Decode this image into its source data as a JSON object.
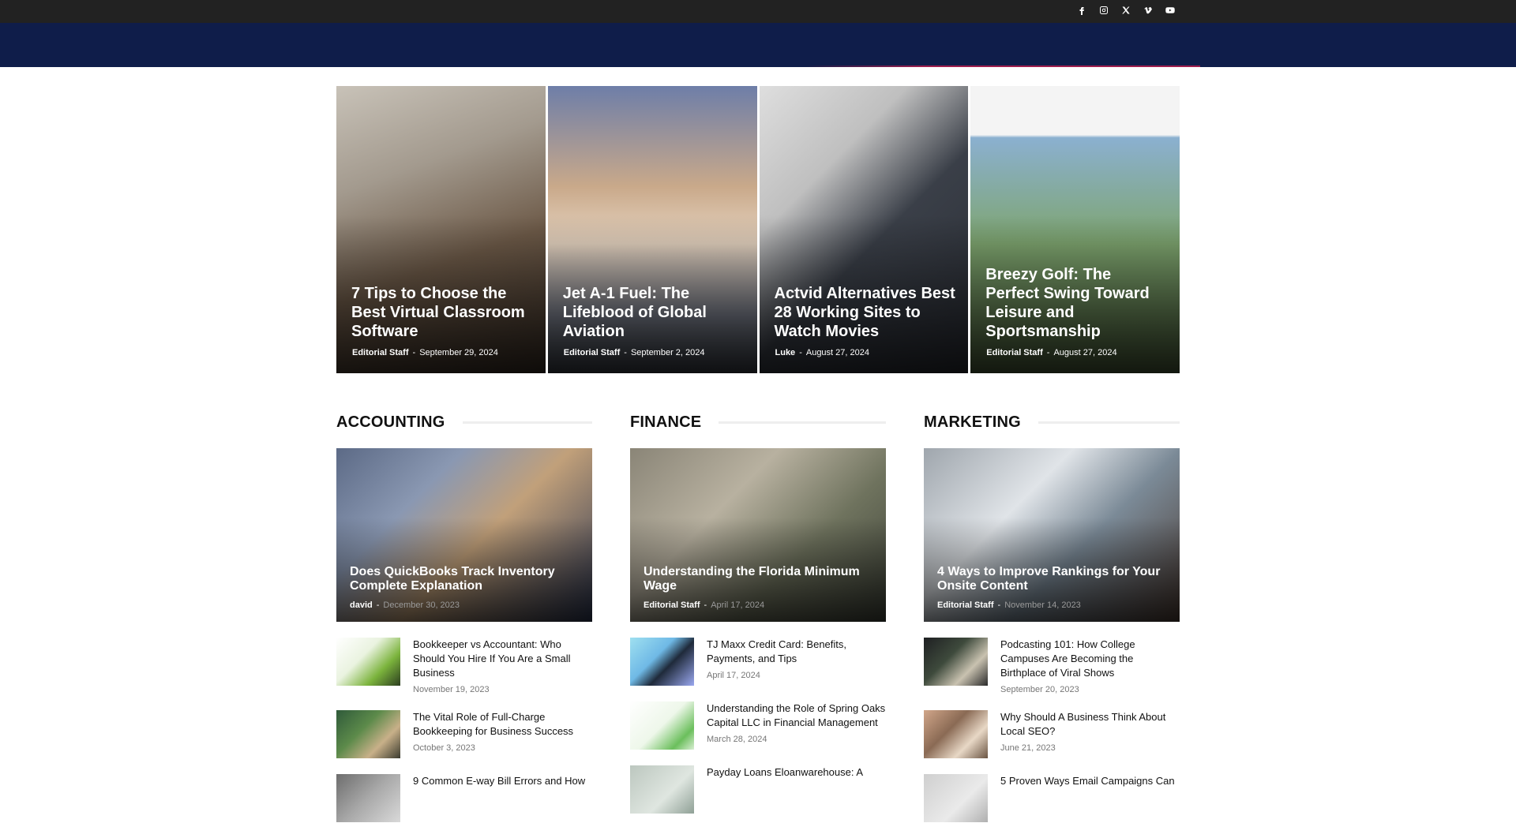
{
  "social": {
    "icons": [
      "facebook-icon",
      "instagram-icon",
      "x-twitter-icon",
      "vimeo-icon",
      "youtube-icon"
    ]
  },
  "colors": {
    "topbar": "#222222",
    "navbar": "#0f1d4a",
    "accent": "#dc1e50"
  },
  "hero": [
    {
      "title": "7 Tips to Choose the Best Virtual Classroom Software",
      "author": "Editorial Staff",
      "date": "September 29, 2024"
    },
    {
      "title": "Jet A-1 Fuel: The Lifeblood of Global Aviation",
      "author": "Editorial Staff",
      "date": "September 2, 2024"
    },
    {
      "title": "Actvid Alternatives Best 28 Working Sites to Watch Movies",
      "author": "Luke",
      "date": "August 27, 2024"
    },
    {
      "title": "Breezy Golf: The Perfect Swing Toward Leisure and Sportsmanship",
      "author": "Editorial Staff",
      "date": "August 27, 2024"
    }
  ],
  "sections": [
    {
      "heading": "ACCOUNTING",
      "feature": {
        "title": "Does QuickBooks Track Inventory Complete Explanation",
        "author": "david",
        "date": "December 30, 2023"
      },
      "items": [
        {
          "title": "Bookkeeper vs Accountant: Who Should You Hire If You Are a Small Business",
          "date": "November 19, 2023"
        },
        {
          "title": "The Vital Role of Full-Charge Bookkeeping for Business Success",
          "date": "October 3, 2023"
        },
        {
          "title": "9 Common E-way Bill Errors and How",
          "date": ""
        }
      ]
    },
    {
      "heading": "FINANCE",
      "feature": {
        "title": "Understanding the Florida Minimum Wage",
        "author": "Editorial Staff",
        "date": "April 17, 2024"
      },
      "items": [
        {
          "title": "TJ Maxx Credit Card: Benefits, Payments, and Tips",
          "date": "April 17, 2024"
        },
        {
          "title": "Understanding the Role of Spring Oaks Capital LLC in Financial Management",
          "date": "March 28, 2024"
        },
        {
          "title": "Payday Loans Eloanwarehouse: A",
          "date": ""
        }
      ]
    },
    {
      "heading": "MARKETING",
      "feature": {
        "title": "4 Ways to Improve Rankings for Your Onsite Content",
        "author": "Editorial Staff",
        "date": "November 14, 2023"
      },
      "items": [
        {
          "title": "Podcasting 101: How College Campuses Are Becoming the Birthplace of Viral Shows",
          "date": "September 20, 2023"
        },
        {
          "title": "Why Should A Business Think About Local SEO?",
          "date": "June 21, 2023"
        },
        {
          "title": "5 Proven Ways Email Campaigns Can",
          "date": ""
        }
      ]
    }
  ]
}
